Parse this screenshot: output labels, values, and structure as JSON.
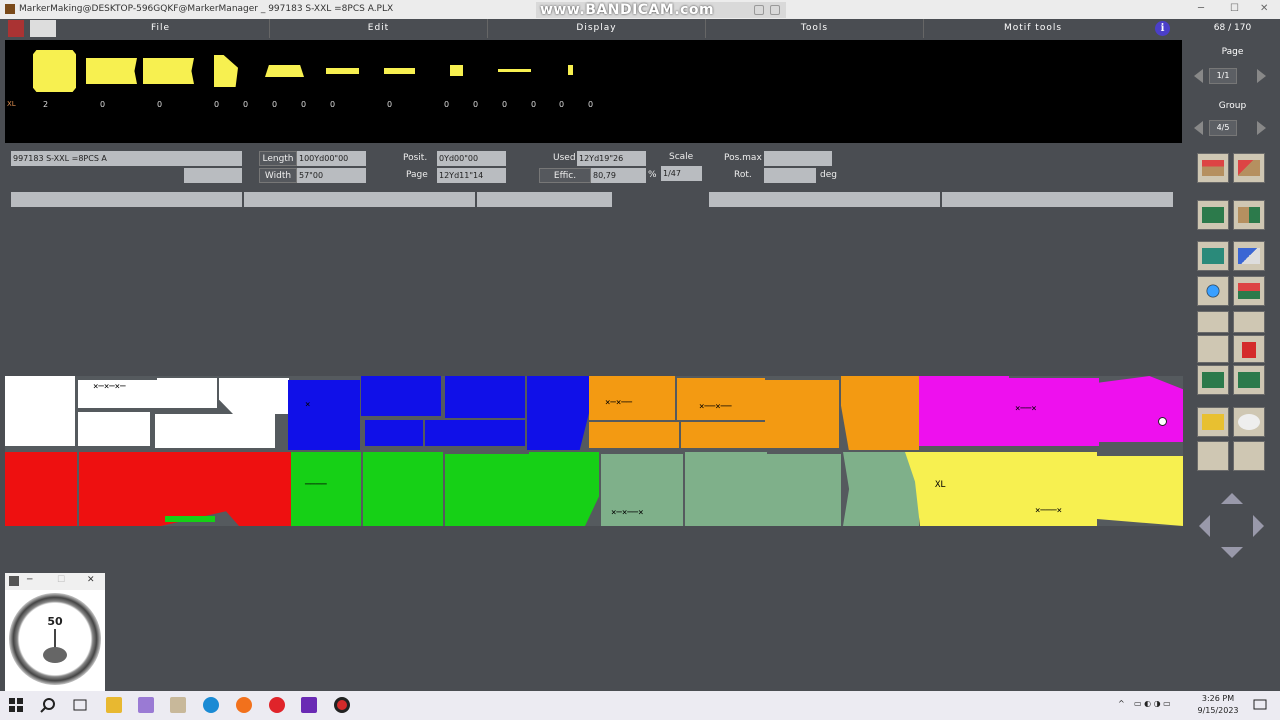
{
  "window": {
    "title": "MarkerMaking@DESKTOP-596GQKF@MarkerManager _ 997183  S-XXL =8PCS A.PLX",
    "watermark": "www.BANDICAM.com",
    "controls": [
      "─",
      "☐",
      "✕"
    ]
  },
  "menu": [
    "File",
    "Edit",
    "Display",
    "Tools",
    "Motif tools"
  ],
  "page_counter": "68 / 170",
  "right_panel": {
    "page_label": "Page",
    "page_value": "1/1",
    "group_label": "Group",
    "group_value": "4/5"
  },
  "pieces": {
    "size": "XL",
    "quantities": [
      "2",
      "0",
      "0",
      "0",
      "0",
      "0",
      "0",
      "0",
      "0",
      "0",
      "0",
      "0",
      "0",
      "0",
      "0"
    ]
  },
  "info": {
    "marker_name": "997183  S-XXL =8PCS A",
    "length_label": "Length",
    "length_value": "100Yd00\"00",
    "width_label": "Width",
    "width_value": "57\"00",
    "posit_label": "Posit.",
    "posit_value": "0Yd00\"00",
    "page_label": "Page",
    "page_value": "12Yd11\"14",
    "used_label": "Used",
    "used_value": "12Yd19\"26",
    "effic_label": "Effic.",
    "effic_value": "80,79",
    "percent": "%",
    "scale_label": "Scale",
    "scale_value": "1/47",
    "posmax_label": "Pos.max",
    "rot_label": "Rot.",
    "deg": "deg"
  },
  "marker": {
    "label_size": "XL",
    "colors": {
      "white": "#ffffff",
      "blue": "#1010e8",
      "orange": "#f39a12",
      "magenta": "#ee10ee",
      "red": "#ee1010",
      "green": "#16d016",
      "sage": "#7fb08a",
      "yellow": "#f7f050"
    }
  },
  "gauge": {
    "value": "50"
  },
  "taskbar": {
    "time": "3:26 PM",
    "date": "9/15/2023"
  }
}
